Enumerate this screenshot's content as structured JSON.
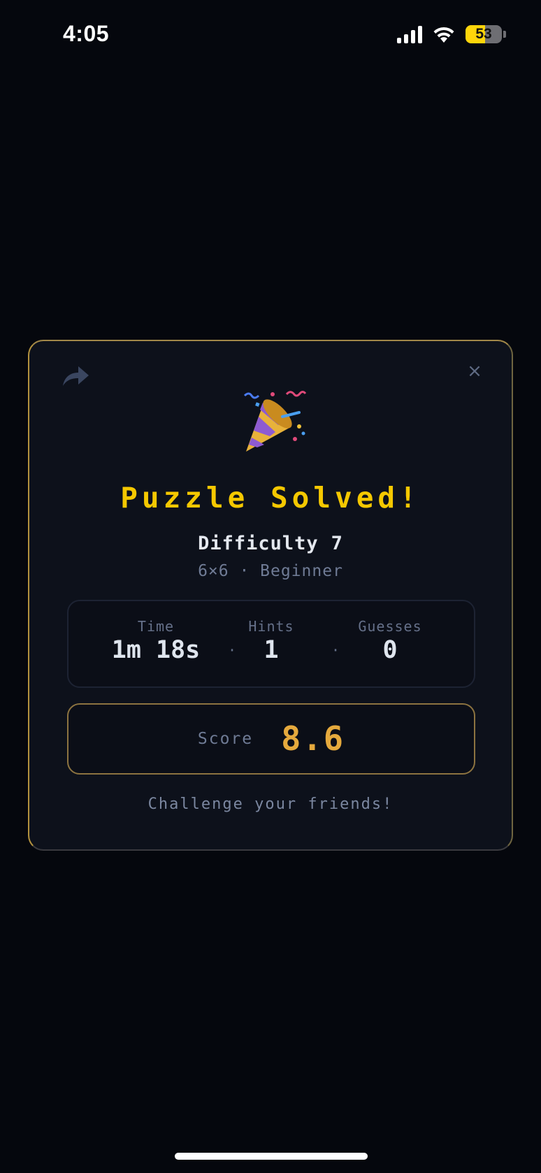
{
  "status_bar": {
    "time": "4:05",
    "battery_percent": "53"
  },
  "dialog": {
    "title": "Puzzle Solved!",
    "difficulty_label": "Difficulty",
    "difficulty_value": "7",
    "subtitle": "6×6 · Beginner",
    "close_symbol": "×",
    "stats": {
      "time_label": "Time",
      "time_value": "1m 18s",
      "hints_label": "Hints",
      "hints_value": "1",
      "guesses_label": "Guesses",
      "guesses_value": "0",
      "separator": "·"
    },
    "score_label": "Score",
    "score_value": "8.6",
    "challenge_text": "Challenge your friends!"
  },
  "icons": {
    "share": "share-arrow-icon",
    "close": "close-icon",
    "celebration": "party-popper-icon"
  },
  "colors": {
    "background": "#05070d",
    "card": "#0d111b",
    "title": "#f5c800",
    "score": "#e5a93d",
    "accent_border": "#b3923e"
  }
}
